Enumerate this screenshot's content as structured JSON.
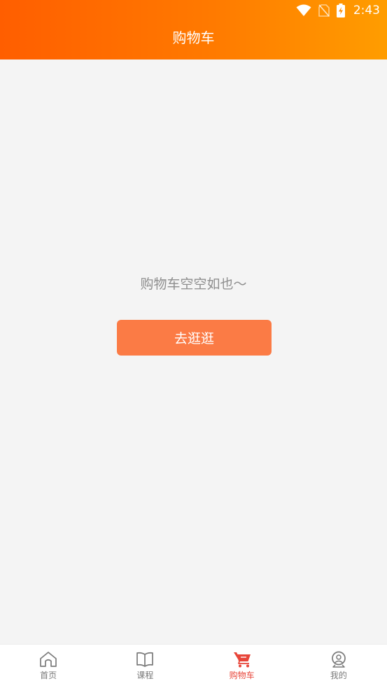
{
  "status_bar": {
    "time": "2:43",
    "icons": [
      "wifi-icon",
      "no-sim-icon",
      "battery-charging-icon"
    ]
  },
  "header": {
    "title": "购物车"
  },
  "empty_state": {
    "message": "购物车空空如也～",
    "button_label": "去逛逛"
  },
  "tab_bar": {
    "active_tab": "购物车",
    "tabs": [
      {
        "label": "首页",
        "icon": "home-icon"
      },
      {
        "label": "课程",
        "icon": "book-icon"
      },
      {
        "label": "购物车",
        "icon": "cart-icon"
      },
      {
        "label": "我的",
        "icon": "profile-icon"
      }
    ]
  },
  "colors": {
    "header_gradient_start": "#ff5e00",
    "header_gradient_end": "#ff9d00",
    "button": "#fb7b45",
    "active_tab": "#e8463a",
    "inactive_tab": "#7a7a7a",
    "background": "#f4f4f4"
  }
}
